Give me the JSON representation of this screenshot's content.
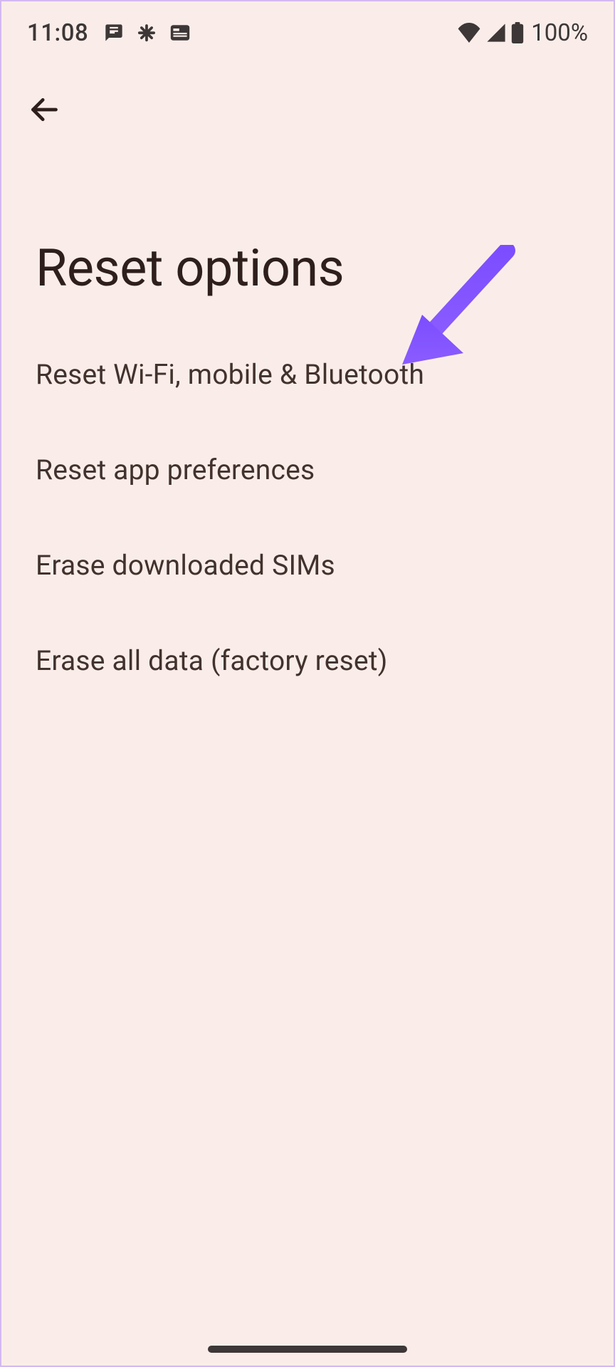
{
  "status": {
    "time": "11:08",
    "battery": "100%"
  },
  "header": {
    "title": "Reset options"
  },
  "options": [
    {
      "label": "Reset Wi-Fi, mobile & Bluetooth"
    },
    {
      "label": "Reset app preferences"
    },
    {
      "label": "Erase downloaded SIMs"
    },
    {
      "label": "Erase all data (factory reset)"
    }
  ],
  "annotation": {
    "arrow_color": "#7c4dff"
  }
}
